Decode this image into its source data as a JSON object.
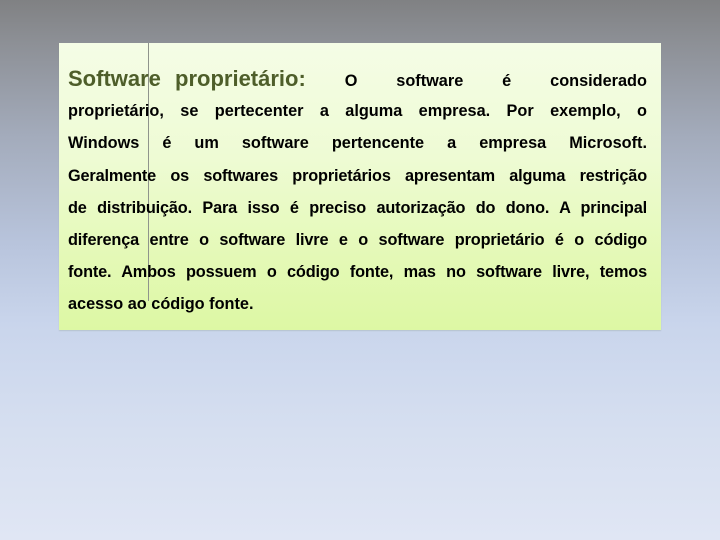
{
  "slide": {
    "title": "Software proprietário:",
    "first_line_words": [
      "O",
      "software",
      "é",
      "considerado"
    ],
    "lines": [
      "proprietário, se pertecenter a alguma empresa. Por exemplo, o",
      "Windows é um software pertencente a empresa Microsoft.",
      "Geralmente os softwares proprietários apresentam alguma restrição",
      "de distribuição. Para isso é preciso autorização do dono. A principal",
      "diferença entre o software livre e o software proprietário é o código",
      "fonte. Ambos possuem o código fonte, mas no software livre, temos",
      "acesso ao código fonte."
    ],
    "colors": {
      "title": "#4e5e2a",
      "body_text": "#000000",
      "box_top": "#f5fde6",
      "box_bottom": "#ddf8a4",
      "background_top": "#808183",
      "background_bottom": "#e0e6f4"
    }
  }
}
